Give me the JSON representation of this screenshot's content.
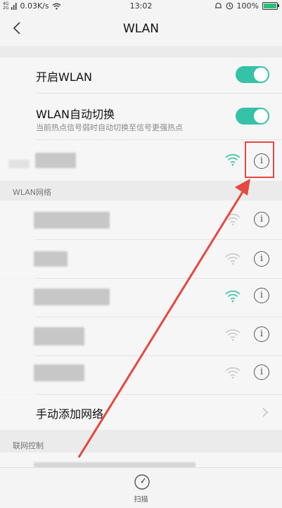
{
  "status_bar": {
    "net_type_top": "4G",
    "net_type_bottom": "2G",
    "speed": "0.03K/s",
    "time": "13:02",
    "battery": "100%"
  },
  "nav": {
    "title": "WLAN"
  },
  "settings": {
    "wlan_toggle_label": "开启WLAN",
    "auto_switch_label": "WLAN自动切换",
    "auto_switch_desc": "当前热点信号弱时自动切换至信号更强热点",
    "wlan_on": true,
    "auto_switch_on": true
  },
  "networks_section": {
    "header": "WLAN网络",
    "add_network_label": "手动添加网络"
  },
  "control_section": {
    "header": "联网控制"
  },
  "bottom_bar": {
    "scan_label": "扫描"
  },
  "colors": {
    "accent": "#35c2a7",
    "highlight": "#e6473f"
  }
}
